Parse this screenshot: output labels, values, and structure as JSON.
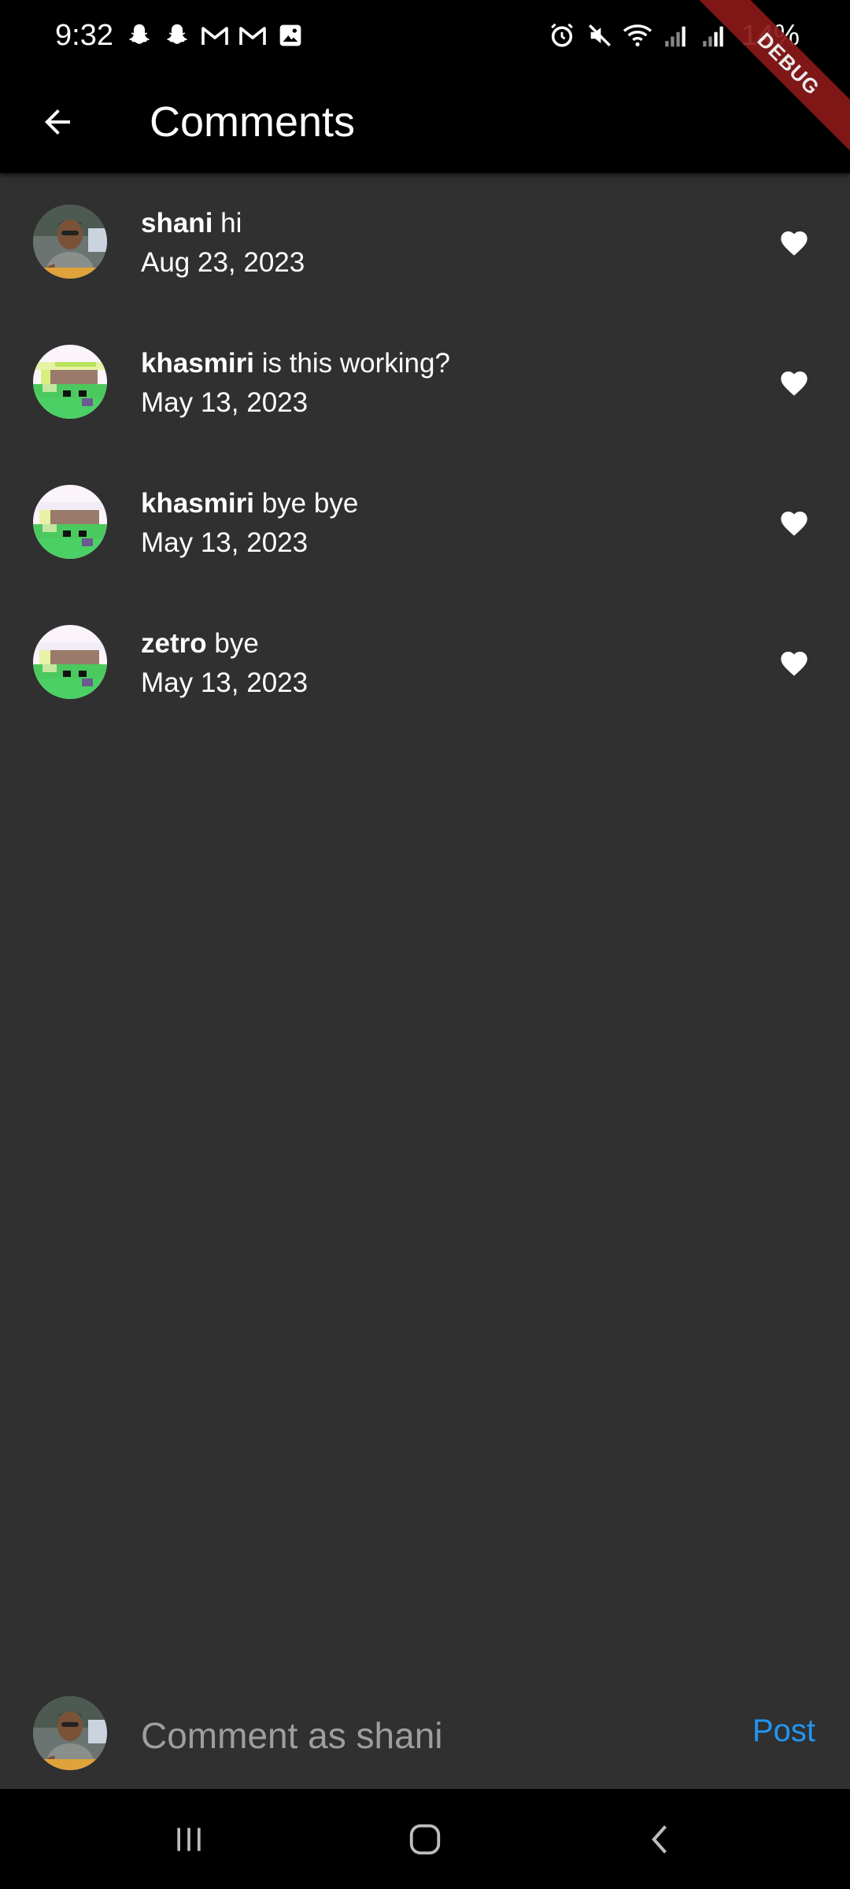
{
  "status_bar": {
    "time": "9:32",
    "battery": "14%",
    "left_icons": [
      "snapchat-icon",
      "snapchat-icon",
      "gmail-icon",
      "gmail-icon",
      "gallery-icon"
    ],
    "right_icons": [
      "alarm-icon",
      "mute-icon",
      "wifi-icon",
      "signal-icon",
      "signal-icon"
    ]
  },
  "debug_banner": "DEBUG",
  "app_bar": {
    "title": "Comments",
    "back_icon": "arrow-back-icon"
  },
  "comments": [
    {
      "username": "shani",
      "text": " hi",
      "date": "Aug 23, 2023",
      "avatar": "photo"
    },
    {
      "username": "khasmiri",
      "text": " is this working?",
      "date": "May 13, 2023",
      "avatar": "pixel"
    },
    {
      "username": "khasmiri",
      "text": " bye bye",
      "date": "May 13, 2023",
      "avatar": "pixel"
    },
    {
      "username": "zetro",
      "text": " bye",
      "date": "May 13, 2023",
      "avatar": "pixel"
    }
  ],
  "composer": {
    "placeholder": "Comment as shani",
    "post_label": "Post"
  },
  "nav_bar": {
    "icons": [
      "recent-apps-icon",
      "home-icon",
      "back-icon"
    ]
  },
  "colors": {
    "background": "#303030",
    "bar": "#000000",
    "accent": "#2196f3",
    "debug": "#8b1a1a"
  }
}
